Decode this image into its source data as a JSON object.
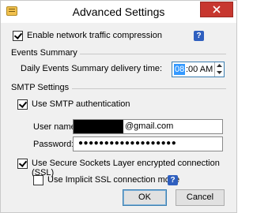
{
  "window": {
    "title": "Advanced Settings"
  },
  "general": {
    "compression_label": "Enable network traffic compression",
    "compression_checked": true
  },
  "events_summary": {
    "section_label": "Events Summary",
    "delivery_label": "Daily Events Summary delivery time:",
    "time_hour": "08",
    "time_rest": ":00 AM"
  },
  "smtp": {
    "section_label": "SMTP Settings",
    "auth_label": "Use SMTP authentication",
    "auth_checked": true,
    "username_label": "User name:",
    "username_value": "@gmail.com",
    "password_label": "Password:",
    "password_value": "●●●●●●●●●●●●●●●●●●●",
    "ssl_label": "Use Secure Sockets Layer encrypted connection (SSL)",
    "ssl_checked": true,
    "implicit_label": "Use Implicit SSL connection mode",
    "implicit_checked": false
  },
  "buttons": {
    "ok": "OK",
    "cancel": "Cancel"
  },
  "icons": {
    "help": "?",
    "close": "close-icon"
  }
}
